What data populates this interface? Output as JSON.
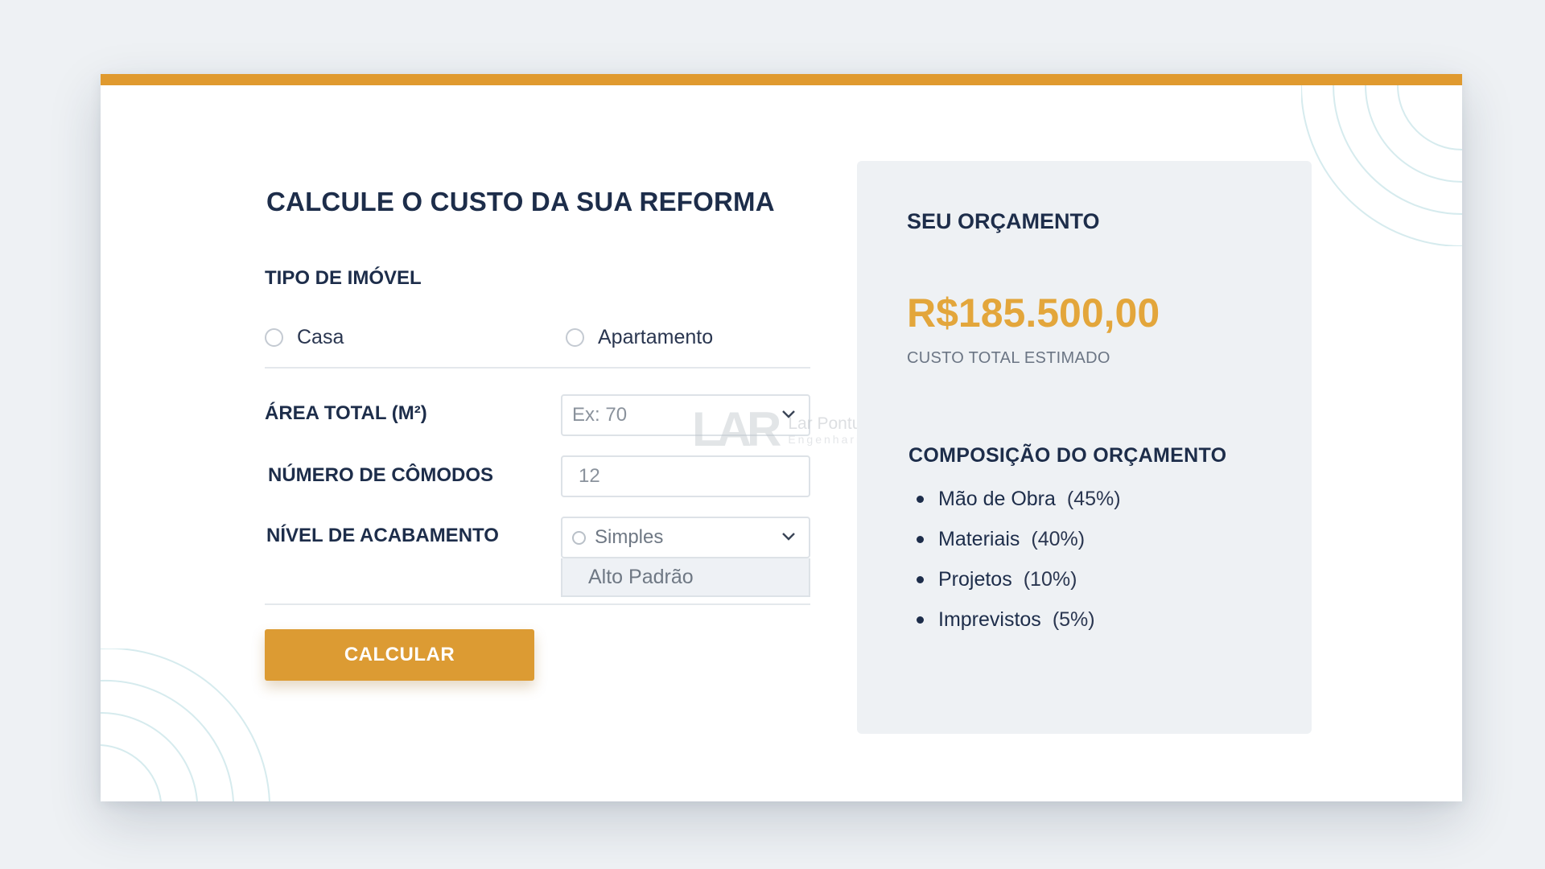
{
  "calculator": {
    "title": "CALCULE O CUSTO DA SUA REFORMA",
    "property_type": {
      "label": "TIPO DE IMÓVEL",
      "options": [
        "Casa",
        "Apartamento"
      ]
    },
    "area": {
      "label": "ÁREA TOTAL (M²)",
      "value": "Ex: 70"
    },
    "rooms": {
      "label": "NÚMERO DE CÔMODOS",
      "value": "12"
    },
    "finish": {
      "label": "NÍVEL DE ACABAMENTO",
      "selected": "Simples",
      "options": [
        "Simples",
        "Alto Padrão"
      ]
    },
    "button_label": "CALCULAR"
  },
  "watermark": {
    "name": "Lar Pontual",
    "sub": "Engenharia"
  },
  "summary": {
    "title": "SEU ORÇAMENTO",
    "amount": "R$185.500,00",
    "amount_caption": "CUSTO TOTAL ESTIMADO",
    "composition_title": "COMPOSIÇÃO DO ORÇAMENTO",
    "items": [
      {
        "label": "Mão de Obra",
        "percent": "(45%)"
      },
      {
        "label": "Materiais",
        "percent": "(40%)"
      },
      {
        "label": "Projetos",
        "percent": "(10%)"
      },
      {
        "label": "Imprevistos",
        "percent": "(5%)"
      }
    ]
  },
  "colors": {
    "accent": "#e09a2f",
    "amount": "#e3a63b",
    "heading": "#1d2d4a",
    "panel": "#eef1f4"
  },
  "icons": [
    "chevron-down-icon",
    "radio-icon",
    "lar-pontual-logo"
  ]
}
